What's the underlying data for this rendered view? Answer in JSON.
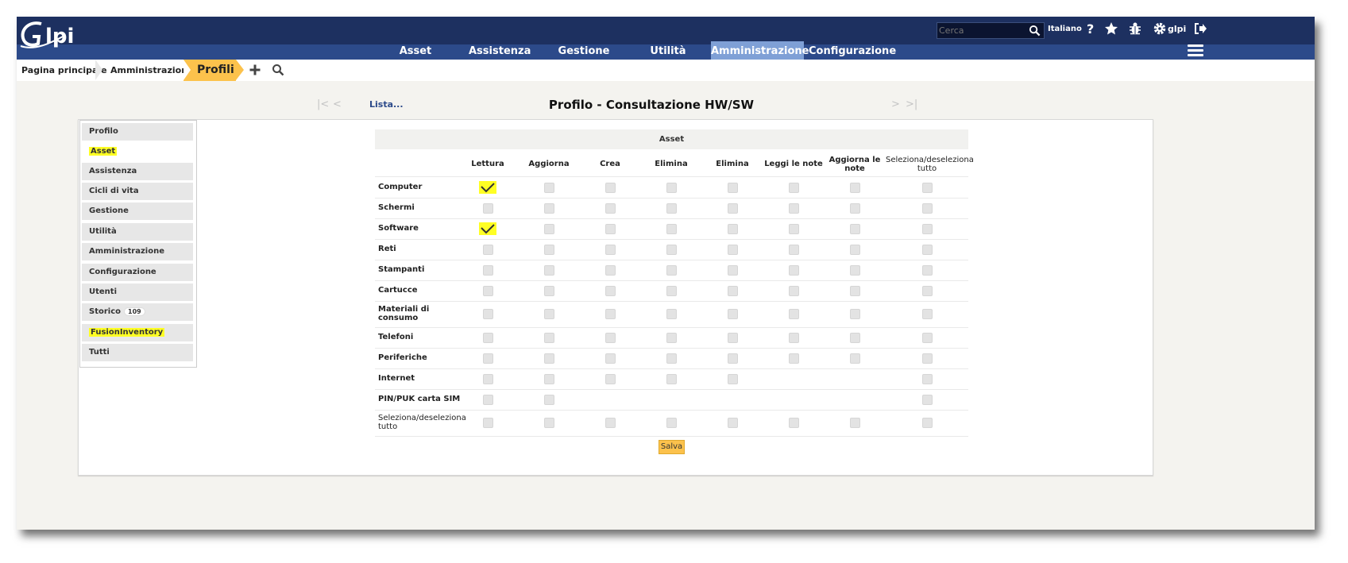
{
  "header": {
    "logo_text": "Glpi",
    "search_placeholder": "Cerca",
    "language": "Italiano",
    "user": "glpi"
  },
  "menu": {
    "items": [
      "Asset",
      "Assistenza",
      "Gestione",
      "Utilità",
      "Amministrazione",
      "Configurazione"
    ],
    "active": "Amministrazione"
  },
  "breadcrumb": {
    "items": [
      "Pagina principale",
      "Amministrazione",
      "Profili"
    ]
  },
  "nav": {
    "list_link": "Lista...",
    "title": "Profilo - Consultazione HW/SW"
  },
  "tabs": [
    {
      "label": "Profilo"
    },
    {
      "label": "Asset",
      "selected": true,
      "highlight": true
    },
    {
      "label": "Assistenza"
    },
    {
      "label": "Cicli di vita"
    },
    {
      "label": "Gestione"
    },
    {
      "label": "Utilità"
    },
    {
      "label": "Amministrazione"
    },
    {
      "label": "Configurazione"
    },
    {
      "label": "Utenti"
    },
    {
      "label": "Storico",
      "badge": "109"
    },
    {
      "label": "FusionInventory",
      "highlight": true
    },
    {
      "label": "Tutti"
    }
  ],
  "rights": {
    "section_title": "Asset",
    "columns": [
      "Lettura",
      "Aggiorna",
      "Crea",
      "Elimina",
      "Elimina",
      "Leggi le note",
      "Aggiorna le note",
      "Seleziona/deseleziona tutto"
    ],
    "rows": [
      {
        "label": "Computer",
        "checked": [
          true,
          false,
          false,
          false,
          false,
          false,
          false,
          false
        ]
      },
      {
        "label": "Schermi"
      },
      {
        "label": "Software",
        "checked": [
          true,
          false,
          false,
          false,
          false,
          false,
          false,
          false
        ]
      },
      {
        "label": "Reti"
      },
      {
        "label": "Stampanti"
      },
      {
        "label": "Cartucce"
      },
      {
        "label": "Materiali di consumo"
      },
      {
        "label": "Telefoni"
      },
      {
        "label": "Periferiche"
      },
      {
        "label": "Internet"
      },
      {
        "label": "PIN/PUK carta SIM"
      },
      {
        "label": "Seleziona/deseleziona tutto"
      }
    ],
    "save_label": "Salva"
  }
}
